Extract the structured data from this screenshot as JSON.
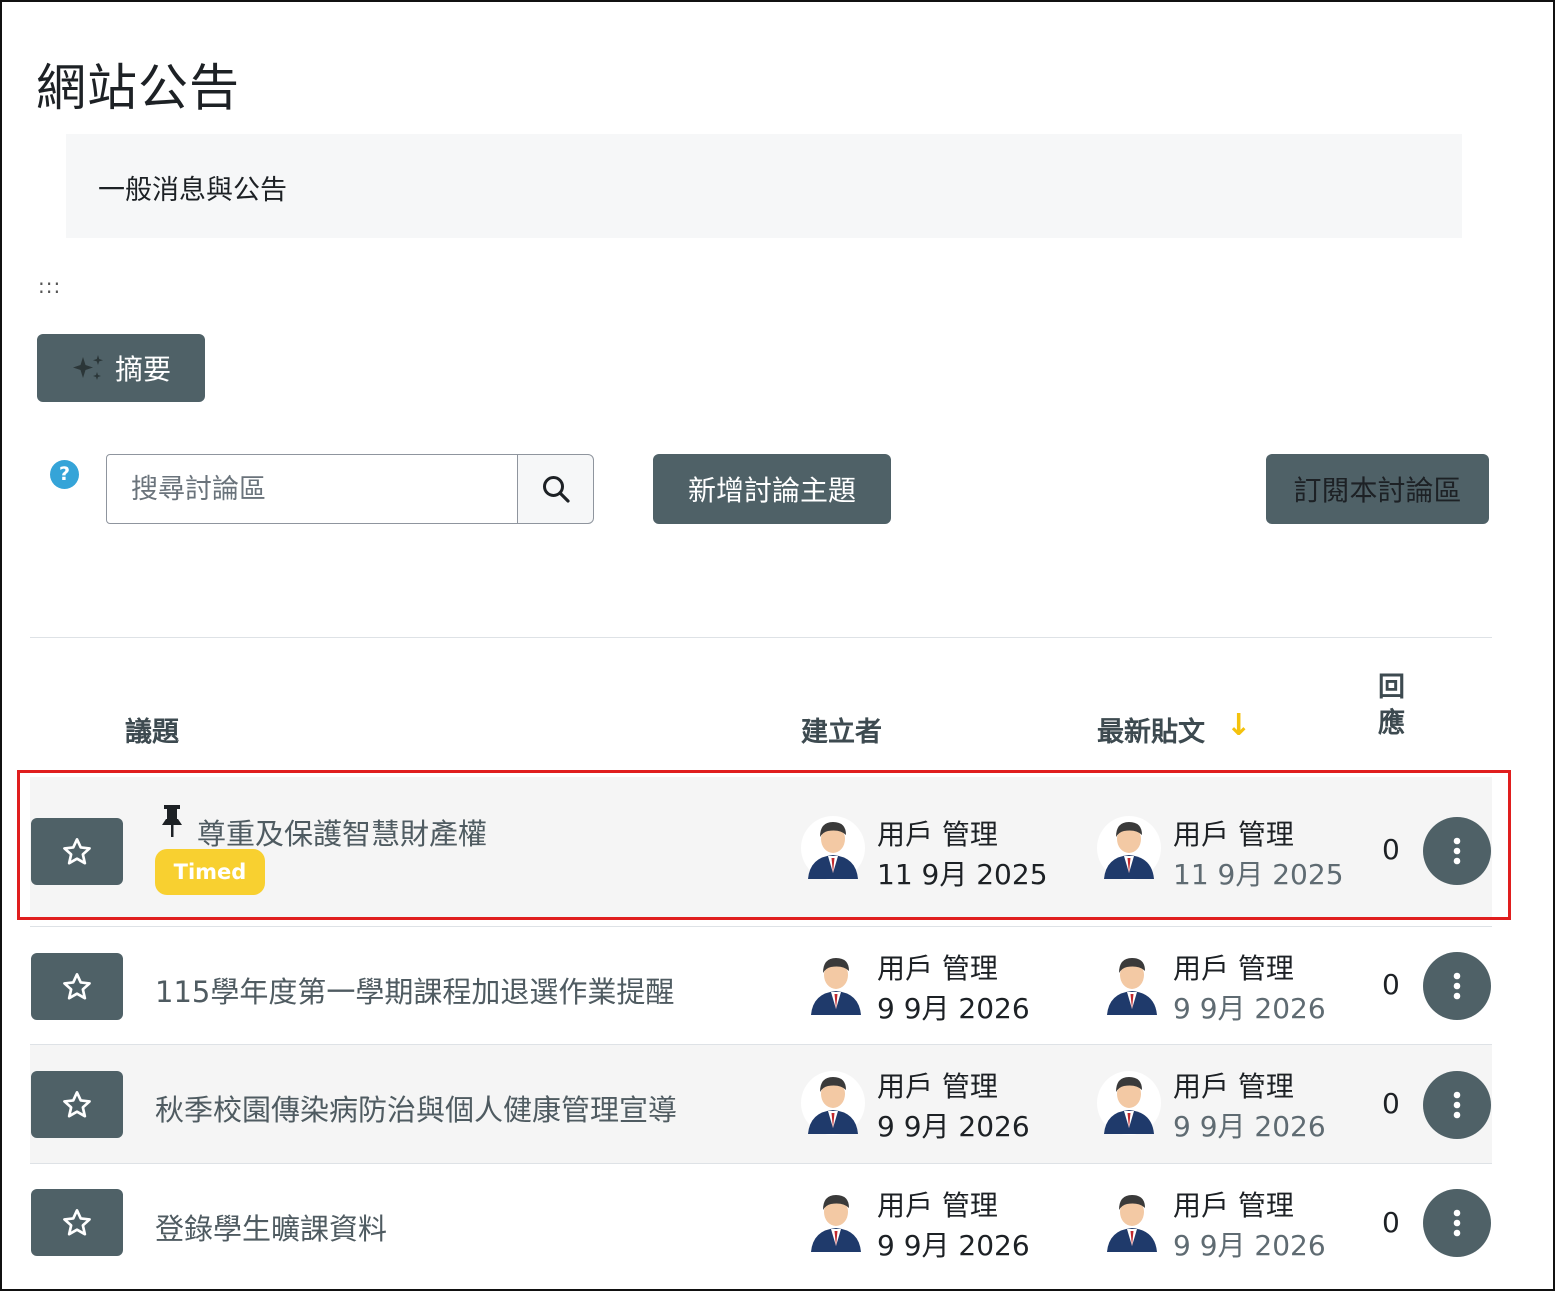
{
  "page": {
    "title": "網站公告"
  },
  "intro": {
    "text": "一般消息與公告"
  },
  "drag_handle": ":::",
  "toolbar": {
    "summary_label": "摘要",
    "search_placeholder": "搜尋討論區",
    "new_topic_label": "新增討論主題",
    "subscribe_label": "訂閱本討論區",
    "help": "?"
  },
  "table": {
    "headers": {
      "topic": "議題",
      "creator": "建立者",
      "latest": "最新貼文",
      "sort_arrow": "↓",
      "replies_line1": "回",
      "replies_line2": "應"
    },
    "rows": [
      {
        "title": "尊重及保護智慧財產權",
        "pinned": true,
        "badge": "Timed",
        "creator_name": "用戶 管理",
        "creator_date": "11 9月 2025",
        "latest_name": "用戶 管理",
        "latest_date": "11 9月 2025",
        "replies": "0"
      },
      {
        "title": "115學年度第一學期課程加退選作業提醒",
        "pinned": false,
        "badge": "",
        "creator_name": "用戶 管理",
        "creator_date": "9 9月 2026",
        "latest_name": "用戶 管理",
        "latest_date": "9 9月 2026",
        "replies": "0"
      },
      {
        "title": "秋季校園傳染病防治與個人健康管理宣導",
        "pinned": false,
        "badge": "",
        "creator_name": "用戶 管理",
        "creator_date": "9 9月 2026",
        "latest_name": "用戶 管理",
        "latest_date": "9 9月 2026",
        "replies": "0"
      },
      {
        "title": "登錄學生曠課資料",
        "pinned": false,
        "badge": "",
        "creator_name": "用戶 管理",
        "creator_date": "9 9月 2026",
        "latest_name": "用戶 管理",
        "latest_date": "9 9月 2026",
        "replies": "0"
      }
    ]
  },
  "icons": [
    "sparkle-icon",
    "help-icon",
    "search-icon",
    "star-icon",
    "pin-icon",
    "avatar",
    "kebab-menu-icon"
  ],
  "colors": {
    "button_bg": "#4f6167",
    "badge_bg": "#f8d030",
    "sort_arrow": "#f4c20d",
    "highlight_border": "#e01e1e",
    "help_icon": "#35a4d8"
  }
}
